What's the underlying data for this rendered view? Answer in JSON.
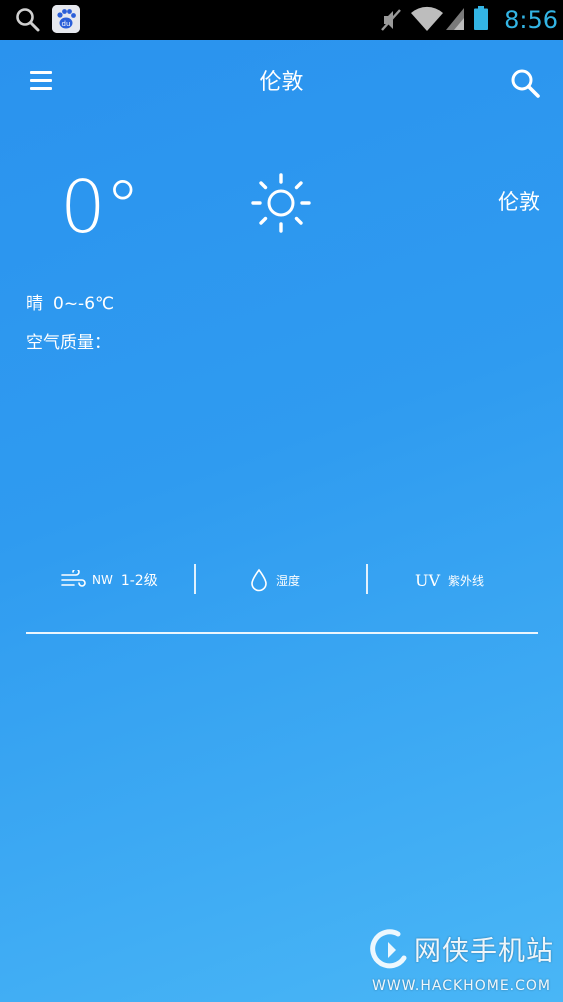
{
  "status_bar": {
    "time": "8:56",
    "icons": [
      "search-icon",
      "baidu-app-icon",
      "mute-icon",
      "wifi-icon",
      "signal-icon",
      "battery-icon"
    ],
    "time_color": "#33b5e5"
  },
  "header": {
    "title": "伦敦",
    "menu_icon": "menu-icon",
    "search_icon": "search-icon"
  },
  "current": {
    "temperature": "0°",
    "weather_icon": "sun-icon",
    "city": "伦敦",
    "condition": "晴",
    "temp_range": "0~-6℃",
    "air_quality_label": "空气质量："
  },
  "details": {
    "wind": {
      "icon": "wind-icon",
      "direction": "NW",
      "level": "1-2级"
    },
    "humidity": {
      "icon": "water-drop-icon",
      "label": "湿度"
    },
    "uv": {
      "mark": "UV",
      "label": "紫外线"
    }
  },
  "watermark": {
    "title": "网侠手机站",
    "url": "WWW.HACKHOME.COM"
  },
  "colors": {
    "background_top": "#2a92ee",
    "background_bottom": "#49b6f6",
    "text": "#ffffff"
  }
}
